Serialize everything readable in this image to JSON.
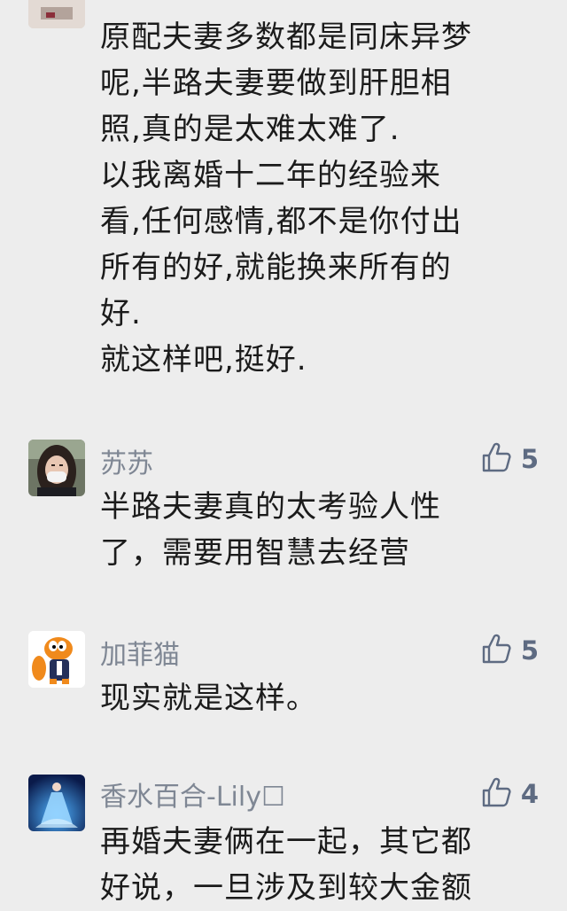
{
  "comments": [
    {
      "username": "",
      "likes": "",
      "avatar": "partial-avatar",
      "lines": [
        "原配夫妻多数都是同床异梦",
        "呢,半路夫妻要做到肝胆相",
        "照,真的是太难太难了.",
        "以我离婚十二年的经验来",
        "看,任何感情,都不是你付出",
        "所有的好,就能换来所有的",
        "好.",
        "就这样吧,挺好."
      ]
    },
    {
      "username": "苏苏",
      "likes": "5",
      "avatar": "woman-with-mask",
      "lines": [
        "半路夫妻真的太考验人性",
        "了，需要用智慧去经营"
      ]
    },
    {
      "username": "加菲猫",
      "likes": "5",
      "avatar": "garfield-cat",
      "lines": [
        "现实就是这样。"
      ]
    },
    {
      "username": "香水百合-Lily☐",
      "likes": "4",
      "avatar": "blue-gown-figure",
      "lines": [
        "再婚夫妻俩在一起，其它都",
        "好说，一旦涉及到较大金额"
      ]
    }
  ],
  "icons": {
    "like": "thumbs-up-icon"
  },
  "colors": {
    "background": "#ededed",
    "username": "#7f8794",
    "like": "#5e6b82",
    "text": "#1b1b1b"
  }
}
